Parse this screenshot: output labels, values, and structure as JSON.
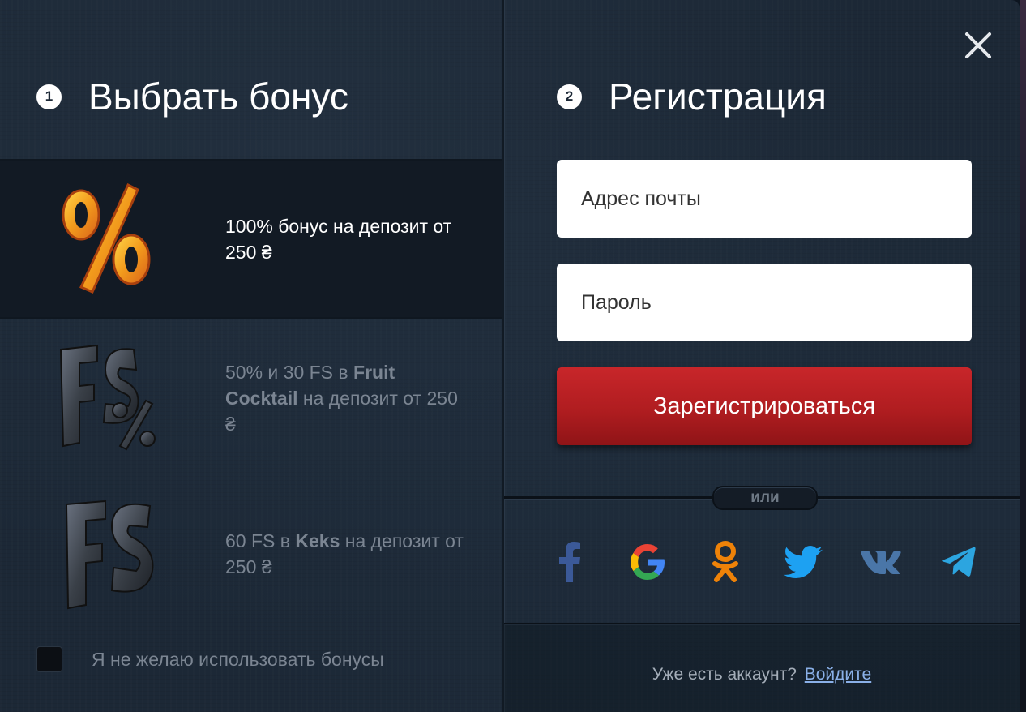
{
  "left": {
    "step_number": "1",
    "title": "Выбрать бонус",
    "bonuses": [
      {
        "text_parts": [
          "100% бонус на депозит от 250 ₴"
        ],
        "icon": "percent-icon",
        "active": true
      },
      {
        "pre": "50% и 30 FS в ",
        "bold": "Fruit Cocktail",
        "post": " на депозит от 250 ₴",
        "icon": "fs-percent-icon",
        "active": false
      },
      {
        "pre": "60 FS в ",
        "bold": "Keks",
        "post": " на депозит от 250 ₴",
        "icon": "fs-icon",
        "active": false
      }
    ],
    "no_bonus_label": "Я не желаю использовать бонусы"
  },
  "right": {
    "step_number": "2",
    "title": "Регистрация",
    "email_placeholder": "Адрес почты",
    "password_placeholder": "Пароль",
    "submit_label": "Зарегистрироваться",
    "or_label": "или",
    "socials": [
      "facebook-icon",
      "google-icon",
      "odnoklassniki-icon",
      "twitter-icon",
      "vk-icon",
      "telegram-icon"
    ],
    "login_question": "Уже есть аккаунт?",
    "login_link": "Войдите"
  },
  "colors": {
    "accent_red": "#c8262a",
    "background": "#1c2836",
    "facebook": "#3b5998",
    "odnoklassniki": "#ee8208",
    "twitter": "#1da1f2",
    "vk": "#4a76a8",
    "telegram": "#2ca5e0"
  }
}
